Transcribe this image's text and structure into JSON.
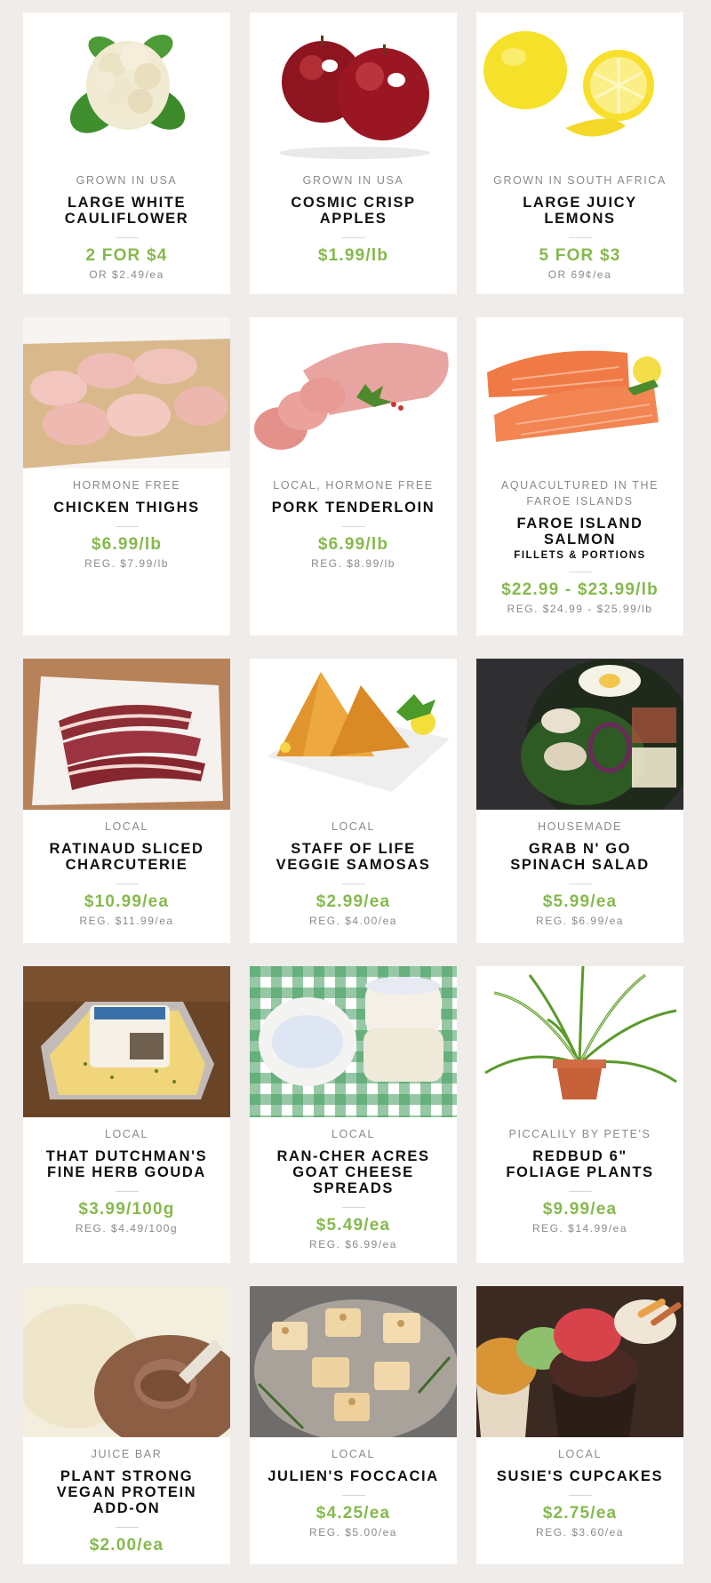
{
  "products": [
    {
      "origin": "GROWN IN USA",
      "name": "LARGE WHITE CAULIFLOWER",
      "price": "2 FOR $4",
      "regular": "OR $2.49/ea",
      "image_icon": "cauliflower-image"
    },
    {
      "origin": "GROWN IN USA",
      "name": "COSMIC CRISP APPLES",
      "price": "$1.99/lb",
      "regular": "",
      "image_icon": "apples-image"
    },
    {
      "origin": "GROWN IN SOUTH AFRICA",
      "name": "LARGE JUICY LEMONS",
      "price": "5 FOR $3",
      "regular": "OR 69¢/ea",
      "image_icon": "lemons-image"
    },
    {
      "origin": "HORMONE FREE",
      "name": "CHICKEN THIGHS",
      "price": "$6.99/lb",
      "regular": "REG. $7.99/lb",
      "image_icon": "chicken-image"
    },
    {
      "origin": "LOCAL, HORMONE FREE",
      "name": "PORK TENDERLOIN",
      "price": "$6.99/lb",
      "regular": "REG. $8.99/lb",
      "image_icon": "pork-image"
    },
    {
      "origin": "AQUACULTURED IN THE FAROE ISLANDS",
      "name": "FAROE ISLAND SALMON",
      "subname": "FILLETS & PORTIONS",
      "price": "$22.99 - $23.99/lb",
      "regular": "REG. $24.99 - $25.99/lb",
      "image_icon": "salmon-image"
    },
    {
      "origin": "LOCAL",
      "name": "RATINAUD SLICED CHARCUTERIE",
      "price": "$10.99/ea",
      "regular": "REG. $11.99/ea",
      "image_icon": "charcuterie-image"
    },
    {
      "origin": "LOCAL",
      "name": "STAFF OF LIFE VEGGIE SAMOSAS",
      "price": "$2.99/ea",
      "regular": "REG. $4.00/ea",
      "image_icon": "samosa-image"
    },
    {
      "origin": "HOUSEMADE",
      "name": "GRAB N' GO SPINACH SALAD",
      "price": "$5.99/ea",
      "regular": "REG. $6.99/ea",
      "image_icon": "salad-image"
    },
    {
      "origin": "LOCAL",
      "name": "THAT DUTCHMAN'S FINE HERB GOUDA",
      "price": "$3.99/100g",
      "regular": "REG. $4.49/100g",
      "image_icon": "gouda-image"
    },
    {
      "origin": "LOCAL",
      "name": "RAN-CHER ACRES GOAT CHEESE SPREADS",
      "price": "$5.49/ea",
      "regular": "REG. $6.99/ea",
      "image_icon": "goat-cheese-image"
    },
    {
      "origin": "PICCALILY BY PETE'S",
      "name": "REDBUD 6\" FOLIAGE PLANTS",
      "price": "$9.99/ea",
      "regular": "REG. $14.99/ea",
      "image_icon": "plant-image"
    },
    {
      "origin": "JUICE BAR",
      "name": "PLANT STRONG VEGAN PROTEIN ADD-ON",
      "price": "$2.00/ea",
      "regular": "",
      "image_icon": "protein-powder-image"
    },
    {
      "origin": "LOCAL",
      "name": "JULIEN'S FOCCACIA",
      "price": "$4.25/ea",
      "regular": "REG. $5.00/ea",
      "image_icon": "foccacia-image"
    },
    {
      "origin": "LOCAL",
      "name": "SUSIE'S CUPCAKES",
      "price": "$2.75/ea",
      "regular": "REG. $3.60/ea",
      "image_icon": "cupcakes-image"
    }
  ],
  "colors": {
    "background": "#efece9",
    "card": "#ffffff",
    "price": "#86b94d",
    "muted": "#8a8a8a",
    "title": "#111111"
  }
}
